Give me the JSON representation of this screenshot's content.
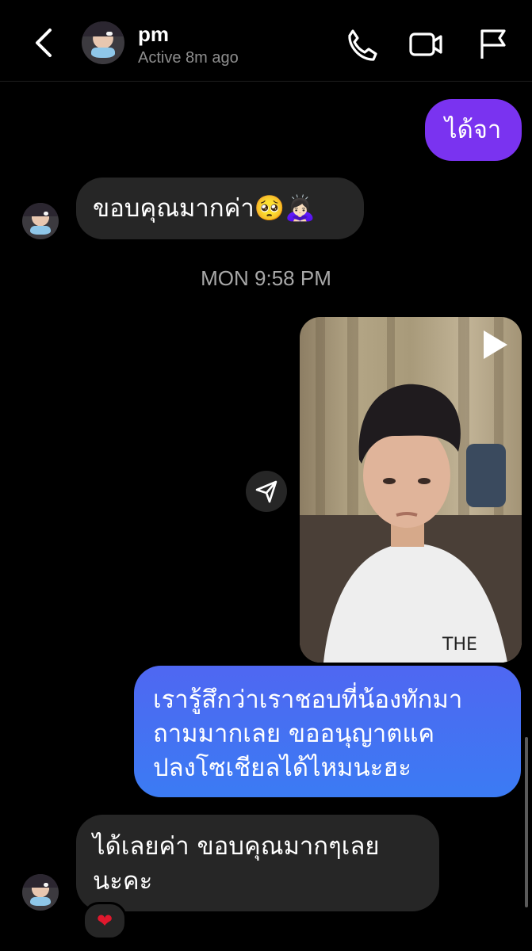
{
  "header": {
    "name": "pm",
    "status": "Active 8m ago"
  },
  "messages": [
    {
      "dir": "out",
      "text": "ได้จา"
    },
    {
      "dir": "in",
      "text": "ขอบคุณมากค่า🥺🙇🏻‍♀️"
    },
    {
      "dir": "out",
      "text_lines": [
        "เรารู้สึกว่าเราชอบที่น้องทักมา",
        "ถามมากเลย ขออนุญาตแค",
        "ปลงโซเชียลได้ไหมนะฮะ"
      ]
    },
    {
      "dir": "in",
      "text_lines": [
        "ได้เลยค่า ขอบคุณมากๆเลย",
        "นะคะ"
      ],
      "reaction": "❤"
    }
  ],
  "timestamp": "MON 9:58 PM",
  "colors": {
    "sent_purple": "#7a33f0",
    "sent_blue": "#3b6cf3",
    "received": "#262626"
  },
  "icons": [
    "back-icon",
    "phone-icon",
    "video-call-icon",
    "flag-icon",
    "play-icon",
    "share-icon",
    "heart-icon"
  ]
}
